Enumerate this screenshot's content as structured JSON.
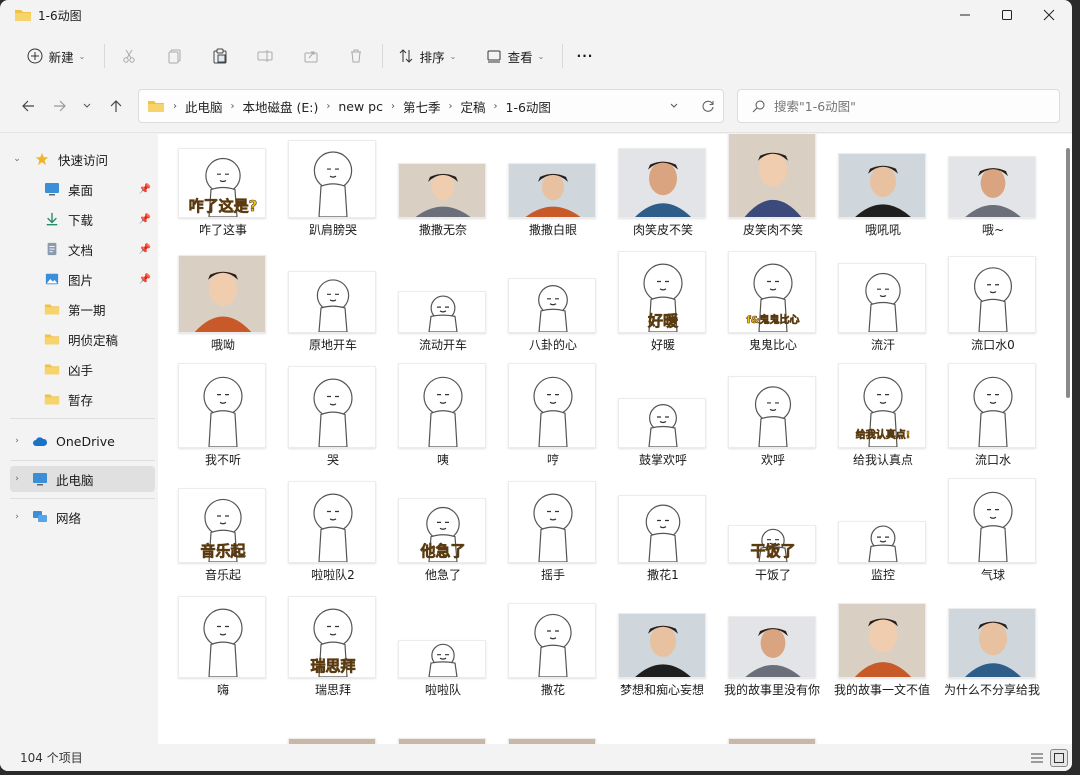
{
  "window": {
    "title": "1-6动图"
  },
  "toolbar": {
    "new_label": "新建",
    "sort_label": "排序",
    "view_label": "查看",
    "more_label": "···"
  },
  "address": {
    "crumbs": [
      "此电脑",
      "本地磁盘 (E:)",
      "new pc",
      "第七季",
      "定稿",
      "1-6动图"
    ]
  },
  "search": {
    "placeholder": "搜索\"1-6动图\""
  },
  "sidebar": {
    "quick_access": "快速访问",
    "items": [
      "桌面",
      "下载",
      "文档",
      "图片",
      "第一期",
      "明侦定稿",
      "凶手",
      "暂存"
    ],
    "onedrive": "OneDrive",
    "this_pc": "此电脑",
    "network": "网络"
  },
  "files": [
    {
      "name": "咋了这事",
      "kind": "sticker",
      "caption": "咋了这是?"
    },
    {
      "name": "趴肩膀哭",
      "kind": "sticker"
    },
    {
      "name": "撒撒无奈",
      "kind": "photo"
    },
    {
      "name": "撒撒白眼",
      "kind": "photo"
    },
    {
      "name": "肉笑皮不笑",
      "kind": "photo"
    },
    {
      "name": "皮笑肉不笑",
      "kind": "photo"
    },
    {
      "name": "哦吼吼",
      "kind": "photo"
    },
    {
      "name": "哦~",
      "kind": "photo"
    },
    {
      "name": "哦呦",
      "kind": "photo"
    },
    {
      "name": "原地开车",
      "kind": "sticker"
    },
    {
      "name": "流动开车",
      "kind": "sticker"
    },
    {
      "name": "八卦的心",
      "kind": "sticker"
    },
    {
      "name": "好暖",
      "kind": "sticker",
      "caption": "好暖"
    },
    {
      "name": "鬼鬼比心",
      "kind": "sticker",
      "caption": "f&鬼鬼比心"
    },
    {
      "name": "流汗",
      "kind": "sticker"
    },
    {
      "name": "流口水0",
      "kind": "sticker"
    },
    {
      "name": "我不听",
      "kind": "sticker"
    },
    {
      "name": "哭",
      "kind": "sticker"
    },
    {
      "name": "咦",
      "kind": "sticker"
    },
    {
      "name": "哼",
      "kind": "sticker"
    },
    {
      "name": "鼓掌欢呼",
      "kind": "sticker"
    },
    {
      "name": "欢呼",
      "kind": "sticker"
    },
    {
      "name": "给我认真点",
      "kind": "sticker",
      "caption": "给我认真点!"
    },
    {
      "name": "流口水",
      "kind": "sticker"
    },
    {
      "name": "音乐起",
      "kind": "sticker",
      "caption": "音乐起"
    },
    {
      "name": "啦啦队2",
      "kind": "sticker"
    },
    {
      "name": "他急了",
      "kind": "sticker",
      "caption": "他急了"
    },
    {
      "name": "摇手",
      "kind": "sticker"
    },
    {
      "name": "撒花1",
      "kind": "sticker"
    },
    {
      "name": "干饭了",
      "kind": "sticker",
      "caption": "干饭了"
    },
    {
      "name": "监控",
      "kind": "sticker"
    },
    {
      "name": "气球",
      "kind": "sticker"
    },
    {
      "name": "嗨",
      "kind": "sticker"
    },
    {
      "name": "瑞思拜",
      "kind": "sticker",
      "caption": "瑞思拜"
    },
    {
      "name": "啦啦队",
      "kind": "sticker"
    },
    {
      "name": "撒花",
      "kind": "sticker"
    },
    {
      "name": "梦想和痴心妄想",
      "kind": "photo"
    },
    {
      "name": "我的故事里没有你",
      "kind": "photo"
    },
    {
      "name": "我的故事一文不值",
      "kind": "photo"
    },
    {
      "name": "为什么不分享给我",
      "kind": "photo"
    }
  ],
  "status": {
    "count": "104 个项目"
  },
  "colors": {
    "folder": "#f0c244",
    "accent": "#1a73c9",
    "selected": "#e0e0e0"
  }
}
